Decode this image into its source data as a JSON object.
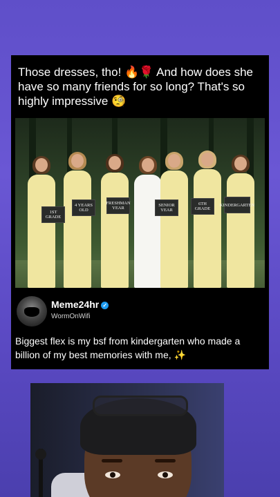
{
  "post": {
    "caption": "Those dresses, tho! 🔥🌹 And how does she have so many friends for so long? That's so highly impressive 🧐",
    "photo": {
      "signs": [
        "1ST GRADE",
        "4 YEARS OLD",
        "FRESHMAN YEAR",
        "SENIOR YEAR",
        "6TH GRADE",
        "KINDERGARTEN"
      ],
      "bridesmaid_dress_color": "#f0e6a0",
      "bride_dress_color": "#f6f6f2"
    },
    "author": {
      "name": "Meme24hr",
      "verified_mark": "✓",
      "handle": "WormOnWifi"
    },
    "text": "Biggest flex is my bsf from kindergarten who made a billion of my best memories with me, ✨"
  },
  "colors": {
    "background": "#6a57d4",
    "card": "#000000",
    "verified": "#1d9bf0"
  },
  "icons": {
    "verified": "verified-badge-icon"
  }
}
